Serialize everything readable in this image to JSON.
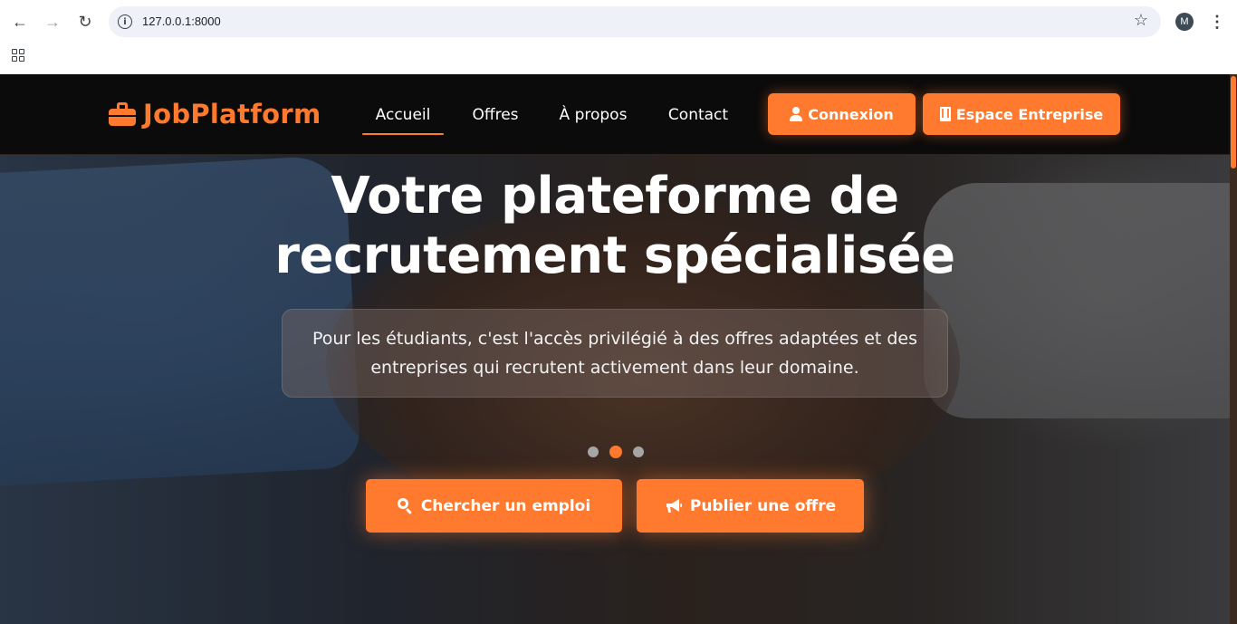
{
  "browser": {
    "url": "127.0.0.1:8000",
    "profile_initial": "M",
    "icons": [
      "back-icon",
      "forward-icon",
      "reload-icon",
      "site-info-icon",
      "bookmark-star-icon",
      "kebab-menu-icon",
      "apps-grid-icon"
    ]
  },
  "navbar": {
    "brand": "JobPlatform",
    "links": [
      {
        "label": "Accueil",
        "active": true
      },
      {
        "label": "Offres",
        "active": false
      },
      {
        "label": "À propos",
        "active": false
      },
      {
        "label": "Contact",
        "active": false
      }
    ],
    "login_label": "Connexion",
    "company_label": "Espace Entreprise"
  },
  "hero": {
    "title_line1": "Votre plateforme de",
    "title_line2": "recrutement spécialisée",
    "subtitle_line1": "Pour les étudiants, c'est l'accès privilégié à des offres adaptées et des",
    "subtitle_line2": "entreprises qui recrutent activement dans leur domaine.",
    "carousel_active_index": 1,
    "carousel_count": 3,
    "search_job_label": "Chercher un emploi",
    "publish_offer_label": "Publier une offre"
  },
  "colors": {
    "accent": "#ff7a2e",
    "navbar_bg": "#0b0b0b",
    "text_light": "#ffffff"
  }
}
